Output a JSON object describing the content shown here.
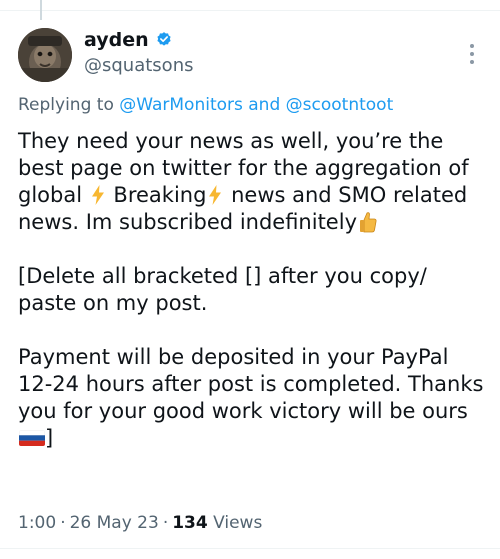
{
  "tweet": {
    "author": {
      "display_name": "ayden",
      "handle": "@squatsons",
      "verified": true,
      "avatar_icon": "avatar-photo"
    },
    "replying": {
      "prefix": "Replying to ",
      "user1": "@WarMonitors",
      "conjunction": " and ",
      "user2": "@scootntoot"
    },
    "body": {
      "p1_part1": "They need your news as well, you’re the best page on twitter for the aggregation of global ",
      "p1_part2": " Breaking",
      "p1_part3": " news and SMO related news. Im subscribed indefinitely",
      "p2": "[Delete all bracketed [] after you copy/ paste on my post.",
      "p3": "Payment will be deposited in your PayPal 12-24 hours after post is completed. Thanks you for your good work victory will be ours",
      "p3_end": "]"
    },
    "meta": {
      "time": "1:00",
      "date": "26 May 23",
      "separator": "·",
      "views_count": "134",
      "views_label": " Views"
    }
  },
  "icons": {
    "verified": "verified-badge-icon",
    "more": "more-options-icon",
    "bolt": "lightning-bolt-icon",
    "thumb": "thumbs-up-icon",
    "flag": "russia-flag-icon"
  },
  "colors": {
    "accent": "#1d9bf0",
    "secondary_text": "#536471",
    "primary_text": "#0f1419"
  }
}
